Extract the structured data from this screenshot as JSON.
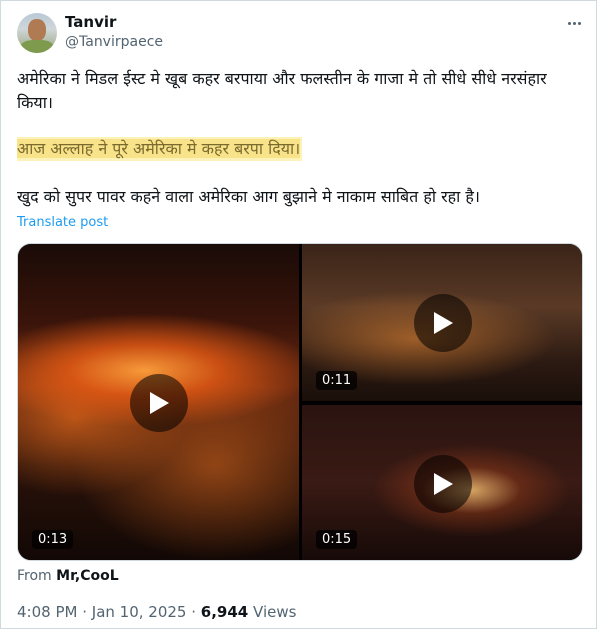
{
  "author": {
    "name": "Tanvir",
    "handle": "@Tanvirpaece"
  },
  "post": {
    "line1": "अमेरिका ने मिडल ईस्ट मे खूब कहर बरपाया और फलस्तीन के गाजा मे तो सीधे सीधे नरसंहार किया।",
    "line2": "आज अल्लाह ने पूरे अमेरिका मे कहर बरपा दिया।",
    "line3": "खुद को सुपर पावर कहने वाला अमेरिका आग बुझाने मे नाकाम साबित हो रहा है।",
    "translate_label": "Translate post"
  },
  "media": {
    "videos": [
      {
        "duration": "0:13"
      },
      {
        "duration": "0:11"
      },
      {
        "duration": "0:15"
      }
    ]
  },
  "source": {
    "prefix": "From",
    "name": "Mr,CooL"
  },
  "meta": {
    "time": "4:08 PM",
    "date": "Jan 10, 2025",
    "views_count": "6,944",
    "views_label": "Views"
  },
  "colors": {
    "link": "#1d9bf0",
    "highlight": "#f8e38a",
    "secondary_text": "#536471"
  }
}
